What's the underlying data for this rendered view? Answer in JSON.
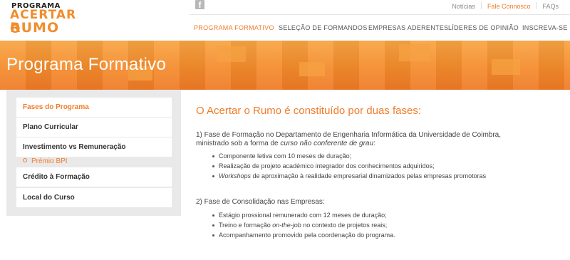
{
  "logo": {
    "line1": "PROGRAMA",
    "line2": "ACERTAR O",
    "line3": "RUMO"
  },
  "social": {
    "facebook_glyph": "f"
  },
  "toplinks": [
    "Notícias",
    "Fale Connosco",
    "FAQs"
  ],
  "nav": [
    "PROGRAMA FORMATIVO",
    "SELEÇÃO DE FORMANDOS",
    "EMPRESAS ADERENTES",
    "LÍDERES DE OPINIÃO",
    "INSCREVA-SE"
  ],
  "banner": {
    "title": "Programa Formativo"
  },
  "sidebar": {
    "items": [
      "Fases do Programa",
      "Plano Curricular",
      "Investimento vs Remuneração",
      "Crédito à Formação",
      "Local do Curso"
    ],
    "sub_item": "Prémio BPI"
  },
  "content": {
    "heading": "O Acertar o Rumo é constituído por duas fases:",
    "phase1": {
      "line1": "1) Fase de Formação no Departamento de Engenharia Informática da Universidade de Coimbra,",
      "line2_start": "ministrado sob a forma de ",
      "line2_em": "curso não conferente de grau",
      "line2_end": ":",
      "bullet1": "Componente letiva com 10 meses de duração;",
      "bullet2": "Realização de projeto académico integrador dos conhecimentos adquiridos;",
      "bullet3_em": "Workshops",
      "bullet3_rest": " de aproximação à realidade empresarial dinamizados pelas empresas promotoras"
    },
    "phase2": {
      "title": "2) Fase de Consolidação nas Empresas:",
      "bullet1": "Estágio prossional remunerado com 12 meses de duração;",
      "bullet2_start": "Treino e formação ",
      "bullet2_em": "on-the-job",
      "bullet2_end": " no contexto de projetos reais;",
      "bullet3": "Acompanhamento promovido pela coordenação do programa."
    }
  }
}
